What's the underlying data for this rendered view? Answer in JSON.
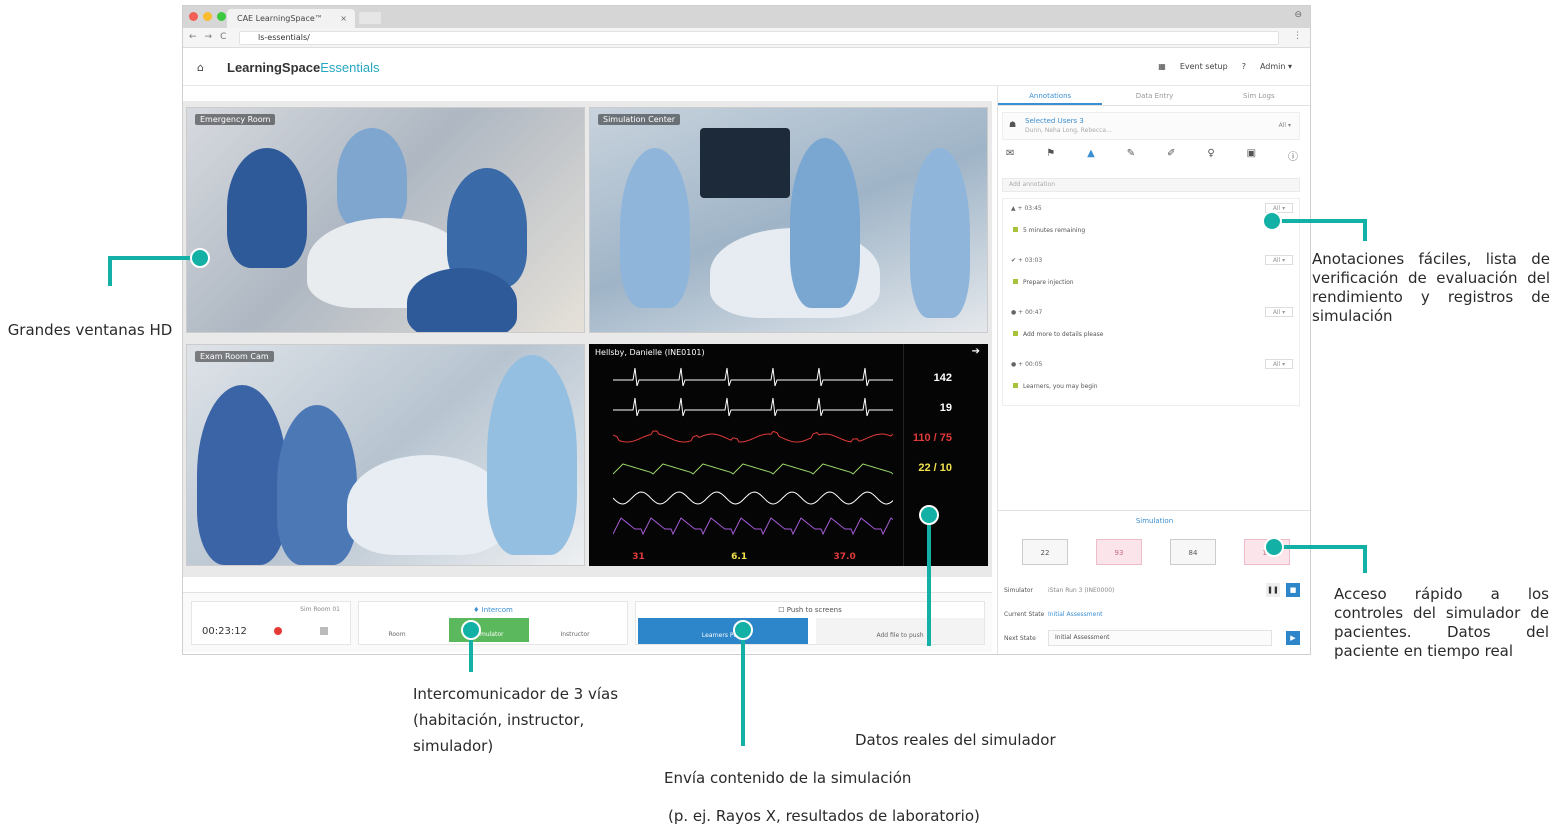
{
  "browser": {
    "tab_title": "CAE LearningSpace™",
    "tab_close": "×",
    "url": "ls-essentials/",
    "nav_back": "←",
    "nav_forward": "→",
    "nav_reload": "C",
    "menu": "⋮",
    "window_control": "⊖"
  },
  "app": {
    "brand_main": "LearningSpace",
    "brand_sub": "Essentials",
    "home_icon": "⌂",
    "header": {
      "grid_icon": "▦",
      "event_setup": "Event setup",
      "help": "?",
      "user": "Admin ▾"
    }
  },
  "videos": [
    {
      "label": "Emergency Room"
    },
    {
      "label": "Simulation Center"
    },
    {
      "label": "Exam Room Cam"
    }
  ],
  "monitor": {
    "patient": "Hellsby, Danielle (INE0101)",
    "arrow": "➔",
    "vitals": [
      "142",
      "19",
      "110 / 75",
      "22 / 10"
    ],
    "vital_colors": [
      "#ffffff",
      "#ffffff",
      "#e23a3a",
      "#f3e24d"
    ],
    "trace_colors": [
      "#ffffff",
      "#ffffff",
      "#e23a3a",
      "#9ad46a",
      "#ffffff",
      "#a45ad6"
    ],
    "bottom_vitals": [
      "31",
      "6.1",
      "37.0"
    ]
  },
  "controls": {
    "timer_label": "Sim Room 01",
    "timer": "00:23:12",
    "intercom_title": "♦ Intercom",
    "intercom_room": "Room",
    "intercom_sim": "Simulator",
    "intercom_instructor": "Instructor",
    "push_title": "☐ Push to screens",
    "push_learners": "Learners Push",
    "push_add": "Add file to push"
  },
  "right_panel": {
    "tabs": [
      "Annotations",
      "Data Entry",
      "Sim Logs"
    ],
    "selected_users": "Selected Users",
    "selected_users_count": "3",
    "selected_users_sub": "Dunn, Neha Long, Rebecca...",
    "users_select": "All ▾",
    "tool_icons": [
      "✉",
      "⚑",
      "▲",
      "✎",
      "✐",
      "♀",
      "▣",
      "ⓘ"
    ],
    "search_placeholder": "Add annotation",
    "annotations": [
      {
        "time": "▲ + 03:45",
        "text": "5 minutes remaining",
        "sel": "All ▾"
      },
      {
        "time": "✔ + 03:03",
        "text": "Prepare injection",
        "sel": "All ▾"
      },
      {
        "time": "● + 00:47",
        "text": "Add more to details please",
        "sel": "All ▾"
      },
      {
        "time": "● + 00:05",
        "text": "Learners, you may begin",
        "sel": "All ▾"
      }
    ],
    "simulation": {
      "title": "Simulation",
      "vitals": [
        "22",
        "93",
        "84",
        "14"
      ],
      "rows": [
        {
          "key": "Simulator",
          "value": "iStan Run 3 (INE0000)"
        },
        {
          "key": "Current State",
          "value": "Initial Assessment"
        },
        {
          "key": "Next State",
          "value": "Initial Assessment"
        }
      ]
    }
  },
  "callouts": {
    "video": "Grandes ventanas HD",
    "annotations": "Anotaciones fáciles, lista de verificación de evaluación del rendimiento y registros de simulación",
    "simulator_controls": "Acceso rápido a los controles del simulador de pacientes. Datos del paciente en tiempo real",
    "intercom": "Intercomunicador de 3 vías (habitación, instructor, simulador)",
    "sim_data": "Datos reales del simulador",
    "push": "Envía contenido de la simulación",
    "push_examples": "(p. ej. Rayos X, resultados de laboratorio)"
  },
  "colors": {
    "accent": "#12b0a5",
    "brand_blue": "#27a7c1",
    "primary_blue": "#2d86c9",
    "intercom_green": "#5cb85c"
  }
}
